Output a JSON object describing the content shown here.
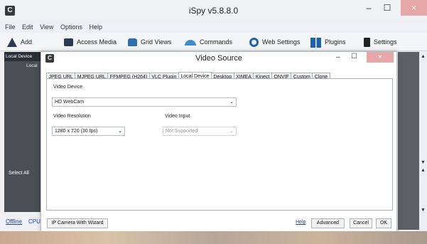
{
  "window": {
    "title": "iSpy v5.8.8.0",
    "logo": "C",
    "min": "–",
    "max": "☐",
    "close": "×"
  },
  "menu": [
    "File",
    "Edit",
    "View",
    "Options",
    "Help"
  ],
  "toolbar": [
    {
      "label": "Add",
      "icon": "add-icon",
      "color": "#2a3a55"
    },
    {
      "label": "Access Media",
      "icon": "media-icon",
      "color": "#2a3a55"
    },
    {
      "label": "Grid Views",
      "icon": "grid-icon",
      "color": "#2f6fb0"
    },
    {
      "label": "Commands",
      "icon": "commands-icon",
      "color": "#3c8ec7"
    },
    {
      "label": "Web Settings",
      "icon": "web-icon",
      "color": "#1d62b0"
    },
    {
      "label": "Plugins",
      "icon": "plugins-icon",
      "color": "#1d62b0"
    },
    {
      "label": "Settings",
      "icon": "settings-icon",
      "color": "#222"
    }
  ],
  "left_panel": {
    "header": "Local Device",
    "sub": "Local",
    "select_all": "Select All"
  },
  "status": {
    "offline": "Offline",
    "cpu": "CPU"
  },
  "dialog": {
    "title": "Video Source",
    "logo": "C",
    "tabs": [
      "JPEG URL",
      "MJPEG URL",
      "FFMPEG (H264)",
      "VLC Plugin",
      "Local Device",
      "Desktop",
      "XIMEA",
      "Kinect",
      "ONVIF",
      "Custom",
      "Clone"
    ],
    "active_tab": "Local Device",
    "video_device_label": "Video Device",
    "video_device_value": "HD WebCam",
    "resolution_label": "Video Resolution",
    "resolution_value": "1280 x 720 (30 fps)",
    "input_label": "Video Input",
    "input_value": "Not Supported",
    "buttons": {
      "wizard": "IP Camera With Wizard",
      "help": "Help",
      "advanced": "Advanced",
      "cancel": "Cancel",
      "ok": "OK"
    }
  },
  "colors": {
    "accent_close": "#e5a7a7",
    "link": "#1f3cb8",
    "panel_dark": "#4a4f55"
  }
}
